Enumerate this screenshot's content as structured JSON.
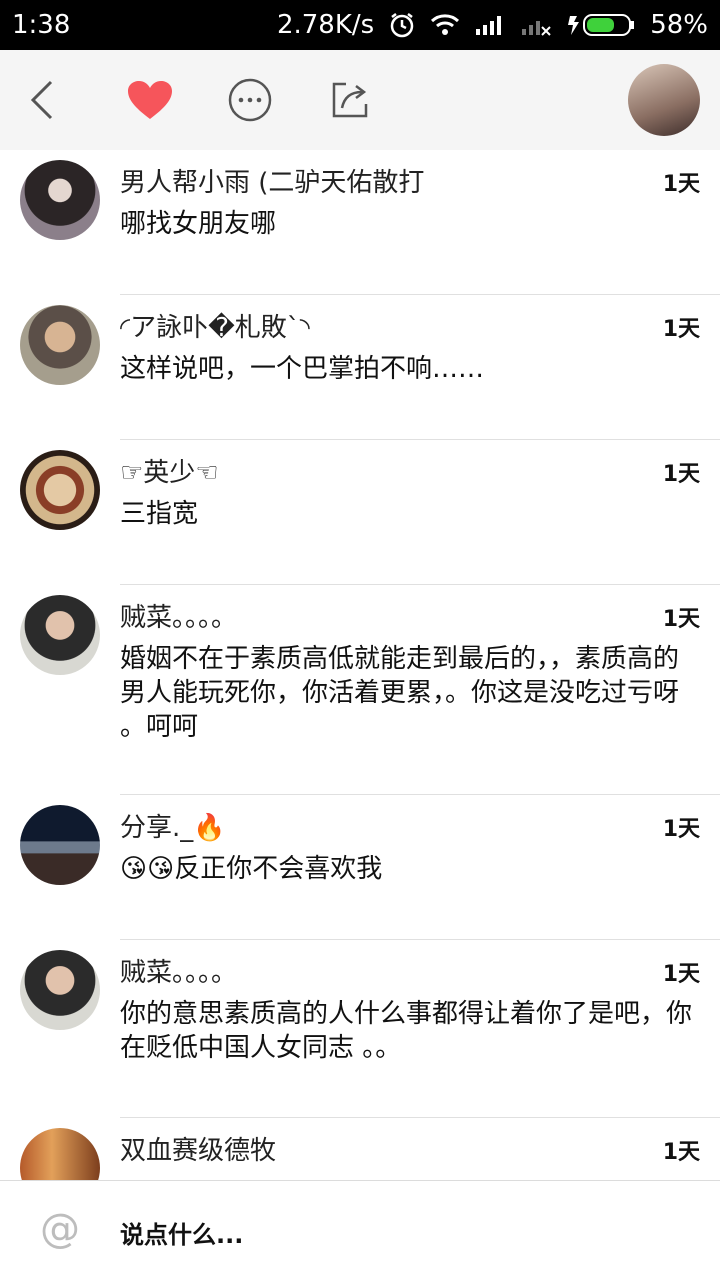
{
  "status_bar": {
    "time": "1:38",
    "net_speed": "2.78K/s",
    "battery": "58%"
  },
  "toolbar": {
    "icons": [
      "back-icon",
      "heart-icon",
      "more-icon",
      "share-icon"
    ],
    "like_color": "#f6555b"
  },
  "comments": [
    {
      "name": "男人帮小雨 (二驴天佑散打",
      "time": "1天",
      "text": "哪找女朋友哪"
    },
    {
      "name": "◜ア詠卟�札敗ˋ◝",
      "time": "1天",
      "text": "这样说吧，一个巴掌拍不响……"
    },
    {
      "name": "☞英少☜",
      "time": "1天",
      "text": "三指宽"
    },
    {
      "name": "贼菜。。。。",
      "time": "1天",
      "text": "婚姻不在于素质高低就能走到最后的，，素质高的男人能玩死你，你活着更累，。你这是没吃过亏呀 。呵呵"
    },
    {
      "name": "分享._🔥",
      "time": "1天",
      "text": "😘😘反正你不会喜欢我"
    },
    {
      "name": "贼菜。。。。",
      "time": "1天",
      "text": "你的意思素质高的人什么事都得让着你了是吧，你在贬低中国人女同志 。。"
    },
    {
      "name": "双血赛级德牧",
      "time": "1天",
      "text": ""
    }
  ],
  "input": {
    "placeholder": "说点什么..."
  }
}
